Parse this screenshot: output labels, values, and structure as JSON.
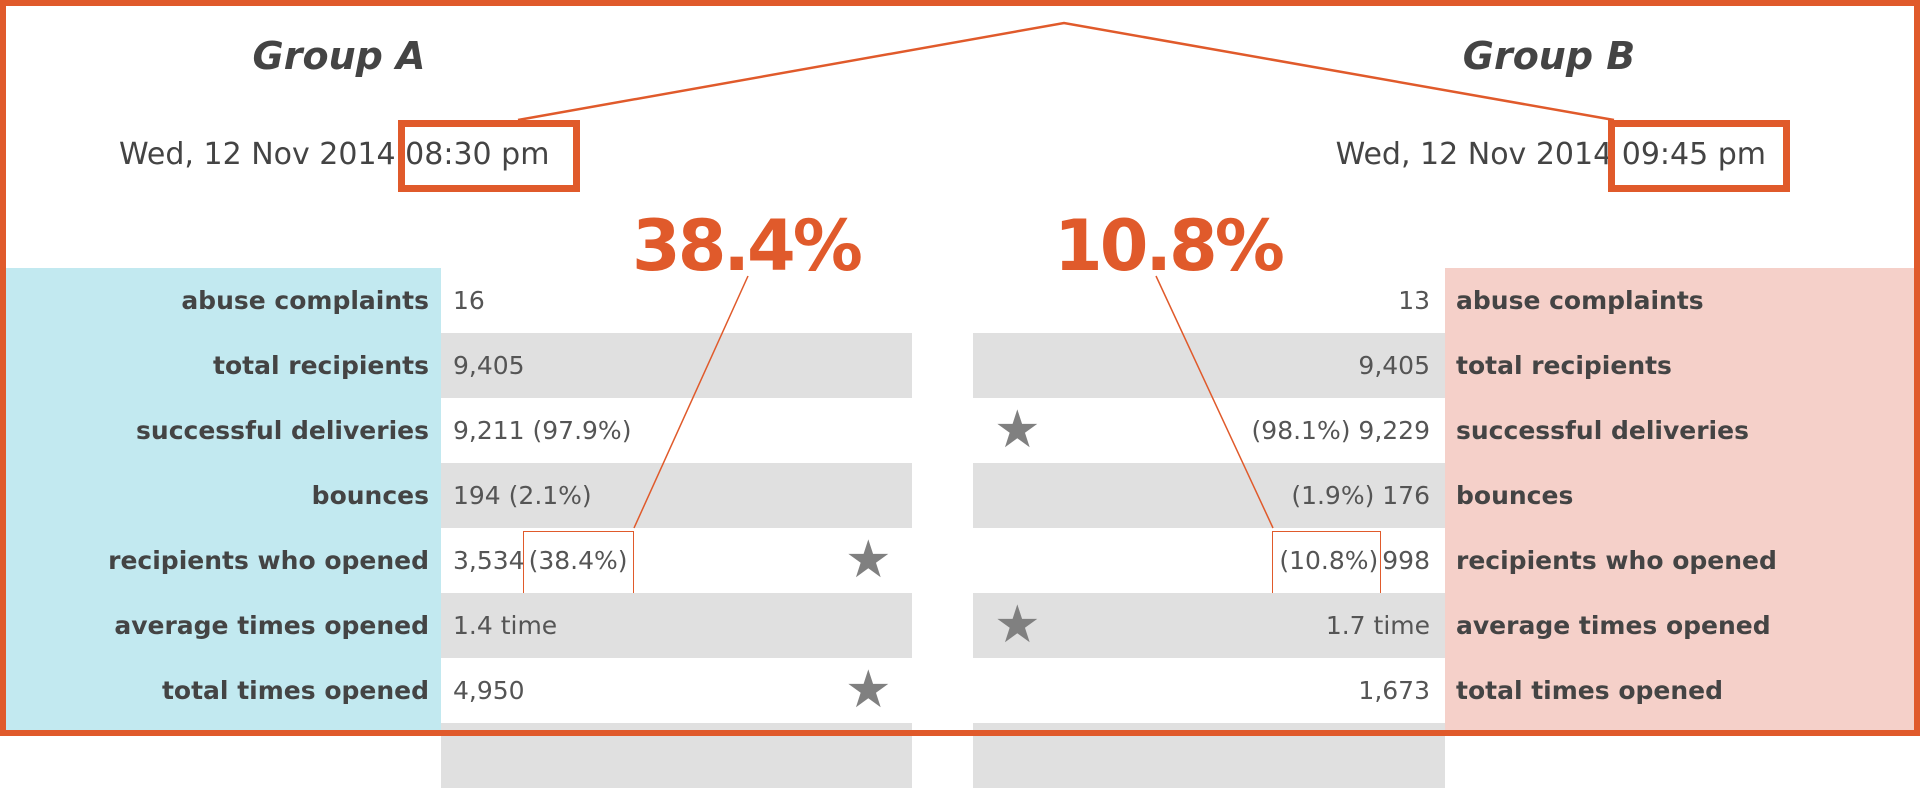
{
  "group_a": {
    "title": "Group A",
    "date": "Wed, 12 Nov 2014",
    "time": "08:30 pm",
    "open_rate": "38.4%",
    "rows": [
      {
        "label": "abuse complaints",
        "value": "16"
      },
      {
        "label": "total recipients",
        "value": "9,405"
      },
      {
        "label": "successful deliveries",
        "value": "9,211 (97.9%)"
      },
      {
        "label": "bounces",
        "value": "194 (2.1%)"
      },
      {
        "label": "recipients who opened",
        "value": "3,534",
        "highlight": "(38.4%)"
      },
      {
        "label": "average times opened",
        "value": "1.4 time"
      },
      {
        "label": "total times opened",
        "value": "4,950"
      }
    ],
    "star_rows": [
      "recipients who opened",
      "total times opened"
    ],
    "panel_color": "#c2e9f0"
  },
  "group_b": {
    "title": "Group B",
    "date": "Wed, 12 Nov 2014",
    "time": "09:45 pm",
    "open_rate": "10.8%",
    "rows": [
      {
        "label": "abuse complaints",
        "value": "13"
      },
      {
        "label": "total recipients",
        "value": "9,405"
      },
      {
        "label": "successful deliveries",
        "value": "(98.1%) 9,229"
      },
      {
        "label": "bounces",
        "value": "(1.9%) 176"
      },
      {
        "label": "recipients who opened",
        "value": "998",
        "highlight": "(10.8%)"
      },
      {
        "label": "average times opened",
        "value": "1.7 time"
      },
      {
        "label": "total times opened",
        "value": "1,673"
      }
    ],
    "star_rows": [
      "successful deliveries",
      "average times opened"
    ],
    "panel_color": "#f5d0c9"
  },
  "icons": {
    "star": "star-icon"
  },
  "colors": {
    "accent": "#e05a2b",
    "row_alt": "#e0e0e0"
  }
}
